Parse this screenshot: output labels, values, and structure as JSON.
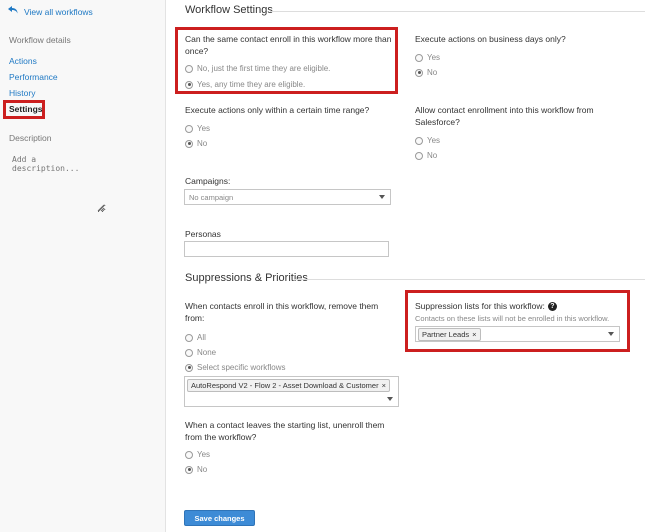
{
  "sidebar": {
    "back_link": "View all workflows",
    "back_icon": "back-arrow-icon",
    "heading": "Workflow details",
    "items": [
      {
        "label": "Actions"
      },
      {
        "label": "Performance"
      },
      {
        "label": "History"
      },
      {
        "label": "Settings",
        "active": true
      }
    ],
    "description_label": "Description",
    "description_placeholder": "Add a description..."
  },
  "settings": {
    "title": "Workflow Settings",
    "reenroll": {
      "question": "Can the same contact enroll in this workflow more than once?",
      "options": [
        "No, just the first time they are eligible.",
        "Yes, any time they are eligible."
      ],
      "selected": 1
    },
    "business_days": {
      "question": "Execute actions on business days only?",
      "options": [
        "Yes",
        "No"
      ],
      "selected": 1
    },
    "time_range": {
      "question": "Execute actions only within a certain time range?",
      "options": [
        "Yes",
        "No"
      ],
      "selected": 1
    },
    "salesforce": {
      "question": "Allow contact enrollment into this workflow from Salesforce?",
      "options": [
        "Yes",
        "No"
      ],
      "selected": -1
    },
    "campaigns": {
      "label": "Campaigns:",
      "value": "No campaign"
    },
    "personas": {
      "label": "Personas",
      "value": ""
    }
  },
  "suppressions": {
    "title": "Suppressions & Priorities",
    "remove_from": {
      "question": "When contacts enroll in this workflow, remove them from:",
      "options": [
        "All",
        "None",
        "Select specific workflows"
      ],
      "selected": 2,
      "selected_workflow": "AutoRespond V2 - Flow 2 - Asset Download & Customer"
    },
    "suppression_lists": {
      "label": "Suppression lists for this workflow:",
      "helper": "Contacts on these lists will not be enrolled in this workflow.",
      "tags": [
        "Partner Leads"
      ]
    },
    "unenroll": {
      "question": "When a contact leaves the starting list, unenroll them from the workflow?",
      "options": [
        "Yes",
        "No"
      ],
      "selected": 1
    }
  },
  "save_button": "Save changes",
  "colors": {
    "link": "#1f79c4",
    "highlight_border": "#cc1f1f",
    "primary_button": "#3d8bd6"
  }
}
